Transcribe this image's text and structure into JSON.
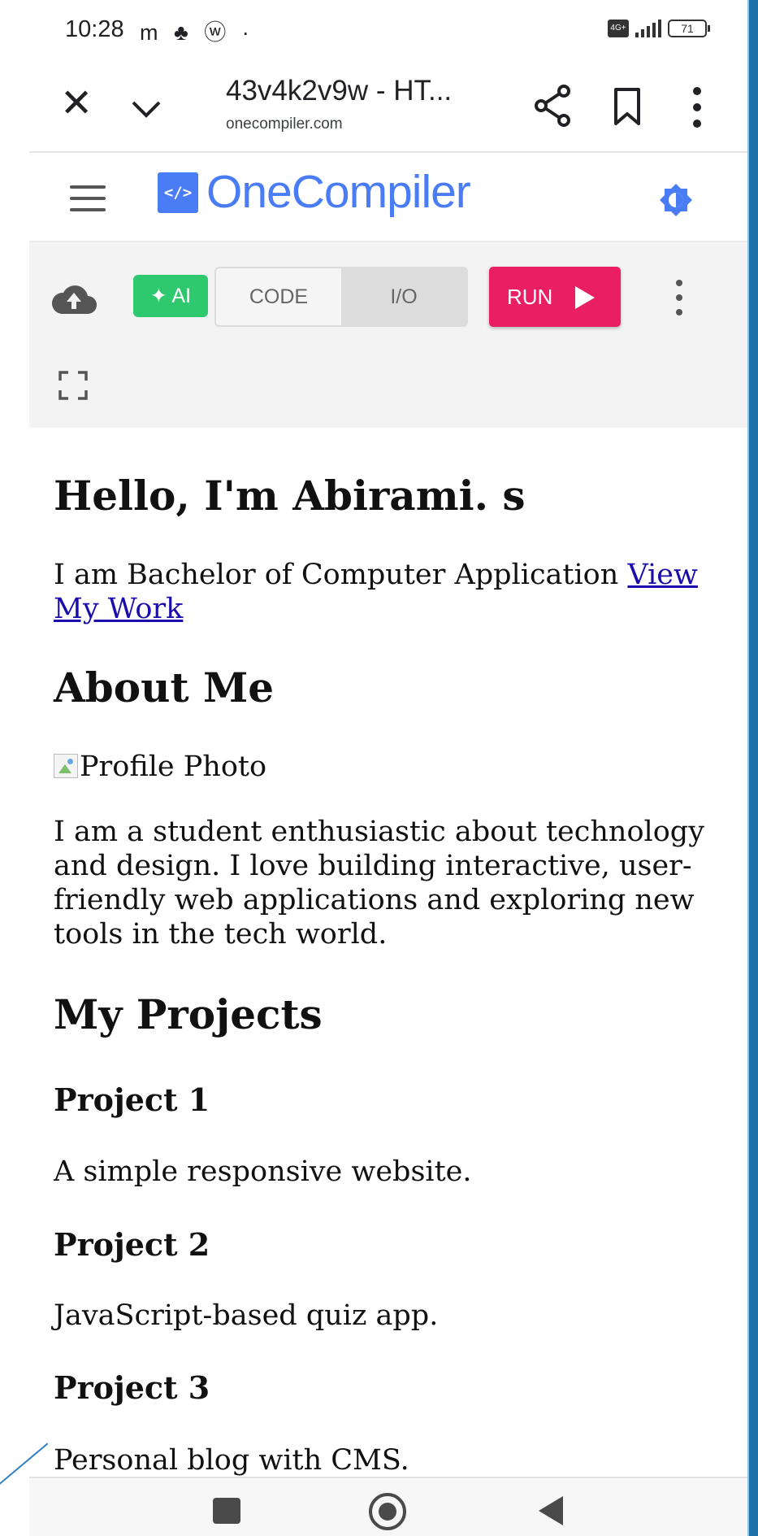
{
  "status_bar": {
    "time": "10:28",
    "left_icons": "m ♣ ⓦ ·",
    "network_badge": "4G+",
    "battery": "71"
  },
  "browser": {
    "close_icon": "close-icon",
    "title": "43v4k2v9w - HT...",
    "url": "onecompiler.com"
  },
  "app_header": {
    "logo_badge": "</>",
    "logo_text": "OneCompiler"
  },
  "toolbar": {
    "ai_label": "✦ AI",
    "tab_code": "CODE",
    "tab_io": "I/O",
    "run_label": "RUN"
  },
  "output": {
    "heading": "Hello, I'm Abirami. s",
    "intro_text": "I am Bachelor of Computer Application",
    "intro_link": "View My Work",
    "about_heading": "About Me",
    "profile_alt": "Profile Photo",
    "about_text": "I am a student enthusiastic about technology and design. I love building interactive, user-friendly web applications and exploring new tools in the tech world.",
    "projects_heading": "My Projects",
    "projects": [
      {
        "title": "Project 1",
        "description": "A simple responsive website."
      },
      {
        "title": "Project 2",
        "description": "JavaScript-based quiz app."
      },
      {
        "title": "Project 3",
        "description": "Personal blog with CMS."
      }
    ]
  },
  "colors": {
    "brand": "#4a7cf5",
    "run": "#e91e63",
    "ai": "#2ec96e",
    "link": "#1a0dab"
  }
}
